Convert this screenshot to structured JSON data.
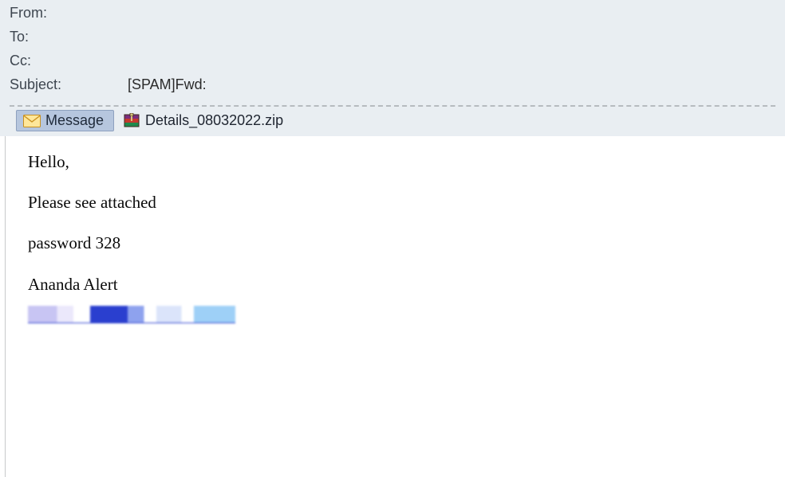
{
  "header": {
    "from_label": "From:",
    "from_value": "",
    "to_label": "To:",
    "to_value": "",
    "cc_label": "Cc:",
    "cc_value": "",
    "subject_label": "Subject:",
    "subject_value": "[SPAM]Fwd:"
  },
  "tabs": {
    "message_label": "Message"
  },
  "attachment": {
    "name": "Details_08032022.zip"
  },
  "body": {
    "line1": "Hello,",
    "line2": "Please see attached",
    "line3": "password 328",
    "line4": "Ananda Alert"
  }
}
